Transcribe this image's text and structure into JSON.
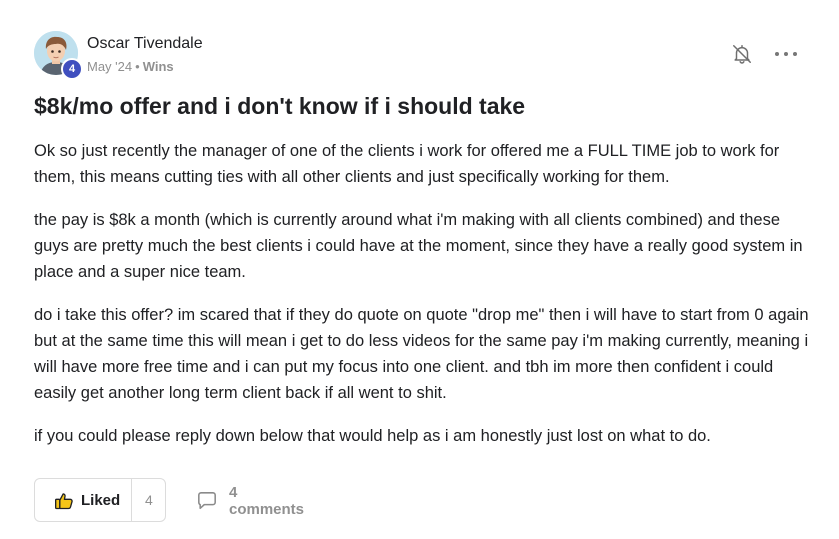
{
  "author": {
    "name": "Oscar Tivendale",
    "level": "4",
    "date": "May '24",
    "separator": "•",
    "category": "Wins"
  },
  "post": {
    "title": "$8k/mo offer and i don't know if i should take",
    "paragraphs": [
      "Ok so just recently the manager of one of the clients i work for offered me a FULL TIME job to work for them, this means cutting ties with all other clients and just specifically working for them.",
      "the pay is $8k a month (which is currently around what i'm making with all clients combined) and these guys are pretty much the best clients i could have at the moment, since they have a really good system in place and a super nice team.",
      "do i take this offer? im scared that if they do quote on quote \"drop me\" then i will have to start from 0 again but at the same time this will mean i get to do less videos for the same pay i'm making currently, meaning i will have more free time and i can put my focus into one client. and tbh im more then confident i could easily get another long term client back if all went to shit.",
      "if you could please reply down below that would help as i am honestly just lost on what to do."
    ]
  },
  "actions": {
    "like_label": "Liked",
    "like_count": "4",
    "comments_label": "4 comments"
  },
  "icons": {
    "notifications_off": "bell-off-icon",
    "more": "more-icon",
    "like": "thumbs-up-icon",
    "comment": "comment-icon"
  },
  "colors": {
    "level_badge": "#3f4fbf",
    "muted_text": "#909090",
    "text": "#202124"
  }
}
